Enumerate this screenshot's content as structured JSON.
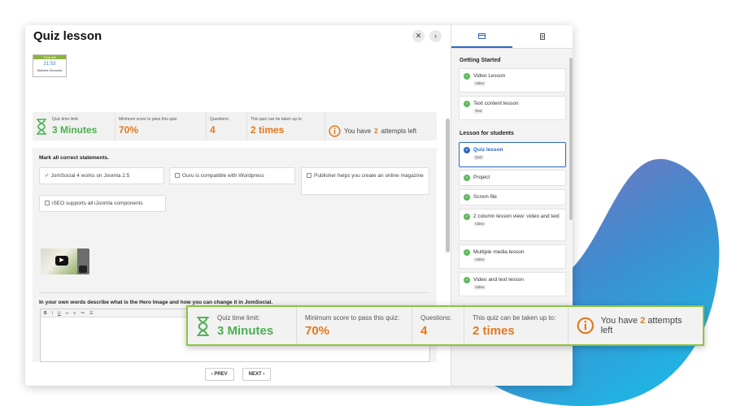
{
  "window": {
    "title": "Quiz lesson"
  },
  "timer": {
    "header": "Time left",
    "clock": "21:53",
    "caption": "Minutes Seconds"
  },
  "stats": {
    "time_limit_label": "Quiz time limit:",
    "time_limit_value": "3 Minutes",
    "min_score_label": "Minimum score to pass this quiz:",
    "min_score_value": "70%",
    "questions_label": "Questions:",
    "questions_value": "4",
    "taken_label": "This quiz can be taken up to:",
    "taken_value": "2 times",
    "attempts_prefix": "You have",
    "attempts_count": "2",
    "attempts_suffix": "attempts left"
  },
  "question1": {
    "text": "Mark all correct statements.",
    "options": [
      "JomSocial 4 works on Joomla 2.5",
      "Guru is compatible with Wordpress",
      "Publisher helps you create an online magazine",
      "iSEO supports all iJoomla components"
    ]
  },
  "question2": {
    "text": "In your own words describe what is the Hero Image and how you can change it in JomSocial.",
    "toolbar": [
      "B",
      "I",
      "U",
      "∞",
      "≡",
      "≔",
      "☰"
    ]
  },
  "nav": {
    "prev": "‹ PREV",
    "next": "NEXT ›"
  },
  "sidebar": {
    "section1": "Getting Started",
    "section2": "Lesson for students",
    "items": [
      {
        "label": "Video Lesson",
        "tag": "Video"
      },
      {
        "label": "Text content lesson",
        "tag": "Text"
      },
      {
        "label": "Quiz lesson",
        "tag": "Quiz"
      },
      {
        "label": "Project",
        "tag": ""
      },
      {
        "label": "Scrom file",
        "tag": ""
      },
      {
        "label": "2 column lesson view: video and text",
        "tag": "Video"
      },
      {
        "label": "Multiple media lesson",
        "tag": "Video"
      },
      {
        "label": "Video and text lesson",
        "tag": "Video"
      }
    ]
  },
  "colors": {
    "green": "#4caf50",
    "orange": "#e2791d",
    "blue": "#2d69c3",
    "zoom_border": "#8cc43f"
  }
}
